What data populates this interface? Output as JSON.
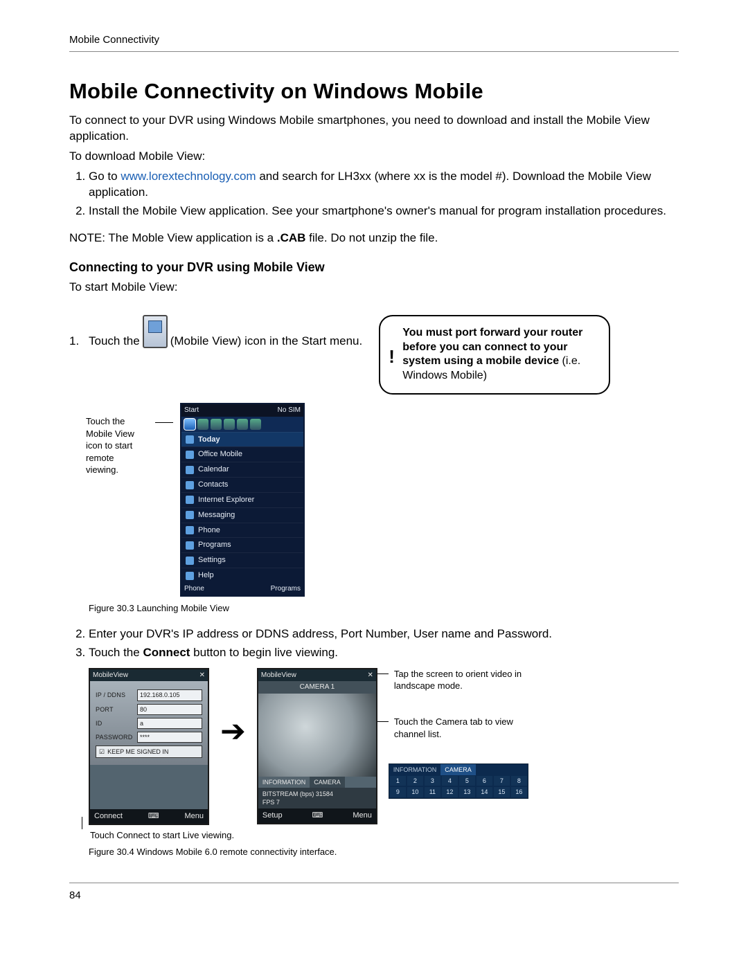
{
  "header": {
    "running": "Mobile Connectivity"
  },
  "title": "Mobile Connectivity on Windows Mobile",
  "intro": "To connect to your DVR using Windows Mobile smartphones, you need to download and install the Mobile View application.",
  "download_lead": "To download Mobile View:",
  "download_steps": {
    "s1a": "Go to ",
    "s1_link": "www.lorextechnology.com",
    "s1b": " and search for LH3xx (where xx is the model #). Download the Mobile View application.",
    "s2": "Install the Mobile View application. See your smartphone's owner's manual for program installation procedures."
  },
  "note_a": "NOTE: The Moble View application is a ",
  "note_b": ".CAB",
  "note_c": " file. Do not unzip the file.",
  "subheading": "Connecting to your DVR using Mobile View",
  "start_lead": "To start Mobile View:",
  "step1": {
    "pre": "Touch the ",
    "post": " (Mobile View) icon in the Start menu."
  },
  "callout": {
    "bold": "You must port forward your router before you can connect to your system using a mobile device",
    "rest": " (i.e. Windows Mobile)"
  },
  "fig1_side": "Touch the Mobile View icon to start remote viewing.",
  "wm_start": {
    "status_left": "Start",
    "status_right": "No SIM",
    "today": "Today",
    "items": [
      "Office Mobile",
      "Calendar",
      "Contacts",
      "Internet Explorer",
      "Messaging",
      "Phone",
      "Programs",
      "Settings",
      "Help"
    ],
    "soft_left": "Phone",
    "soft_right": "Programs"
  },
  "fig1_caption": "Figure 30.3 Launching Mobile View",
  "step2": "Enter your DVR's IP address or DDNS address, Port Number, User name and Password.",
  "step3a": "Touch the ",
  "step3b": "Connect",
  "step3c": " button to begin live viewing.",
  "mv_login": {
    "title": "MobileView",
    "ip_label": "IP / DDNS",
    "ip_value": "192.168.0.105",
    "port_label": "PORT",
    "port_value": "80",
    "id_label": "ID",
    "id_value": "a",
    "pw_label": "PASSWORD",
    "pw_value": "****",
    "keep": "KEEP ME SIGNED IN",
    "soft_left": "Connect",
    "soft_right": "Menu"
  },
  "mv_live": {
    "title": "MobileView",
    "cam_label": "CAMERA 1",
    "tab_info": "INFORMATION",
    "tab_cam": "CAMERA",
    "bitstream_label": "BITSTREAM (bps)",
    "bitstream_value": "31584",
    "fps_label": "FPS",
    "fps_value": "7",
    "soft_left": "Setup",
    "soft_right": "Menu"
  },
  "side_notes": {
    "n1": "Tap the screen to orient video in landscape mode.",
    "n2": "Touch the Camera tab to view channel list."
  },
  "cam_strip": {
    "tab_info": "INFORMATION",
    "tab_cam": "CAMERA",
    "cells": [
      "1",
      "2",
      "3",
      "4",
      "5",
      "6",
      "7",
      "8",
      "9",
      "10",
      "11",
      "12",
      "13",
      "14",
      "15",
      "16"
    ]
  },
  "connect_note": "Touch Connect to start Live viewing.",
  "fig2_caption": "Figure 30.4 Windows Mobile 6.0 remote connectivity interface.",
  "page_number": "84"
}
